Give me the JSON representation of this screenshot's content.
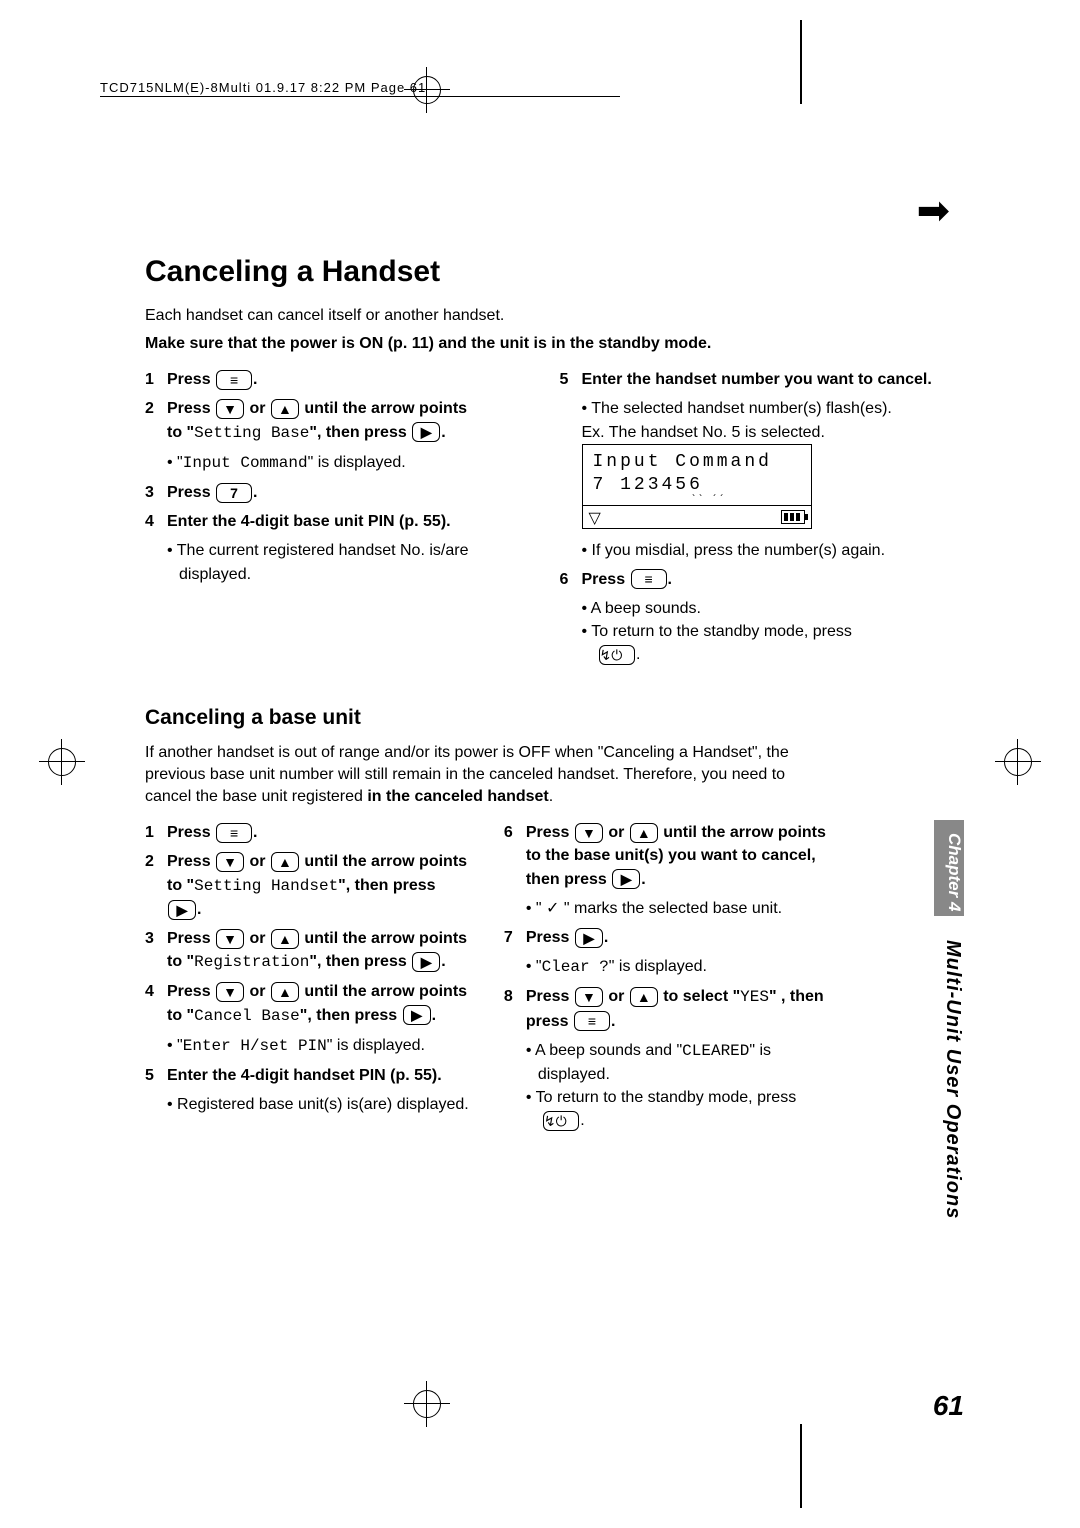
{
  "header": "TCD715NLM(E)-8Multi  01.9.17 8:22 PM  Page 61",
  "title": "Canceling a Handset",
  "intro1": "Each handset can cancel itself or another handset.",
  "intro2": "Make sure that the power is ON (p. 11) and the unit is in the standby mode.",
  "sec1": {
    "left": {
      "s1": {
        "pre": "Press "
      },
      "s2": {
        "pre": "Press ",
        "mid": " or ",
        "post": " until the arrow points",
        "line2a": "to \"",
        "line2code": "Setting Base",
        "line2b": "\", then press ",
        "bullet_a": "\"",
        "bullet_code": "Input Command",
        "bullet_b": "\" is displayed."
      },
      "s3": {
        "pre": "Press ",
        "key": "7"
      },
      "s4": {
        "line": "Enter the 4-digit base unit PIN (p. 55).",
        "bullet": "The current registered handset No. is/are displayed."
      }
    },
    "right": {
      "s5": {
        "line": "Enter the handset number you want to cancel.",
        "bullet": "The selected handset number(s) flash(es).",
        "ex": "Ex. The handset No. 5 is selected.",
        "lcd_row1": "Input Command",
        "lcd_row2": " 7 123456",
        "bullet2": "If you misdial, press the number(s) again."
      },
      "s6": {
        "pre": "Press ",
        "bullet1": "A beep sounds.",
        "bullet2": "To return to the standby mode, press"
      }
    }
  },
  "subtitle": "Canceling a base unit",
  "sub_intro": "If another handset is out of range and/or its power is OFF when \"Canceling a Handset\", the previous base unit number will still remain in the canceled handset. Therefore, you need to cancel the base unit registered ",
  "sub_intro_bold": "in the canceled handset",
  "sec2": {
    "left": {
      "s1": {
        "pre": "Press "
      },
      "s2": {
        "pre": "Press ",
        "mid": " or ",
        "post": " until the arrow points",
        "line2a": "to \"",
        "line2code": "Setting Handset",
        "line2b": "\", then press"
      },
      "s3": {
        "pre": "Press ",
        "mid": " or ",
        "post": " until the arrow points",
        "line2a": "to \"",
        "line2code": "Registration",
        "line2b": "\", then press "
      },
      "s4": {
        "pre": "Press ",
        "mid": " or ",
        "post": " until the arrow points",
        "line2a": "to \"",
        "line2code": "Cancel Base",
        "line2b": "\", then press ",
        "bullet_a": "\"",
        "bullet_code": "Enter H/set PIN",
        "bullet_b": "\" is displayed."
      },
      "s5": {
        "line": "Enter the 4-digit handset PIN (p. 55).",
        "bullet": "Registered base unit(s) is(are) displayed."
      }
    },
    "right": {
      "s6": {
        "pre": "Press ",
        "mid": " or ",
        "post": " until the arrow points",
        "line2": "to the base unit(s) you want to cancel, then press ",
        "bullet": "\" ✓ \" marks the selected base unit."
      },
      "s7": {
        "pre": "Press ",
        "bullet_a": "\"",
        "bullet_code": "Clear ?",
        "bullet_b": "\" is displayed."
      },
      "s8": {
        "pre": "Press ",
        "mid": " or ",
        "post": " to select \"",
        "code": "YES",
        "post2": "\" , then",
        "line2": "press ",
        "bullet1a": "A beep sounds and \"",
        "bullet1code": "CLEARED",
        "bullet1b": "\" is displayed.",
        "bullet2": "To return to the standby mode, press"
      }
    }
  },
  "side": {
    "tab": "Chapter 4",
    "text": "Multi-Unit User Operations"
  },
  "page_num": "61"
}
